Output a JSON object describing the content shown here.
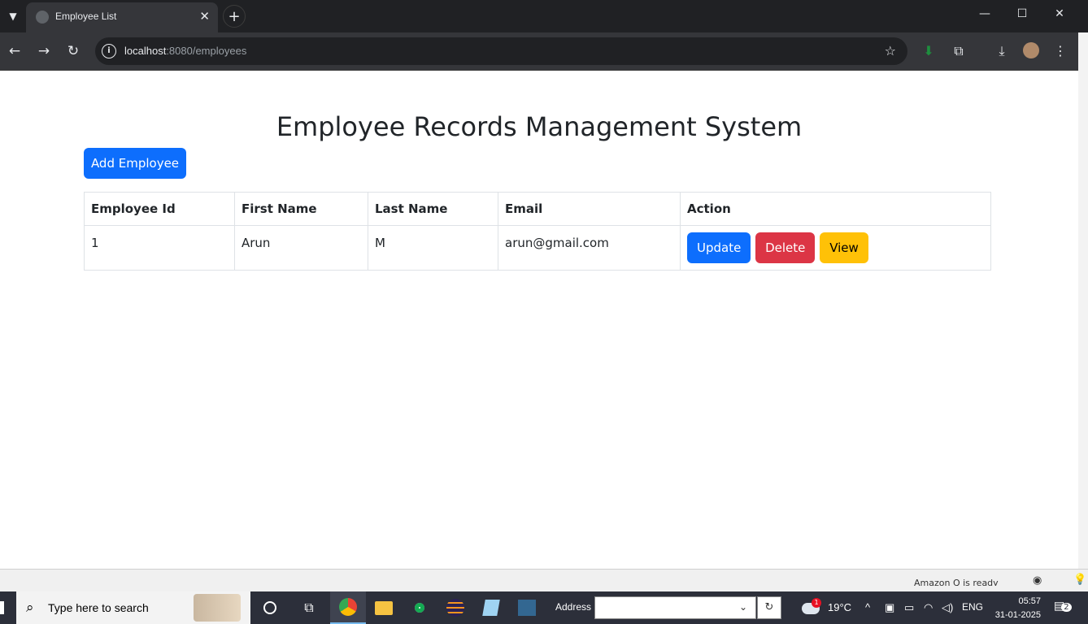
{
  "browser": {
    "tab_title": "Employee List",
    "url_host": "localhost",
    "url_rest": ":8080/employees"
  },
  "page": {
    "title": "Employee Records Management System",
    "add_button": "Add Employee",
    "table": {
      "headers": [
        "Employee Id",
        "First Name",
        "Last Name",
        "Email",
        "Action"
      ],
      "rows": [
        {
          "id": "1",
          "first_name": "Arun",
          "last_name": "M",
          "email": "arun@gmail.com"
        }
      ],
      "actions": {
        "update": "Update",
        "delete": "Delete",
        "view": "View"
      }
    }
  },
  "statusbar": {
    "text": "Amazon Q is ready"
  },
  "taskbar": {
    "search_placeholder": "Type here to search",
    "address_label": "Address",
    "temperature": "19°C",
    "language": "ENG",
    "time": "05:57",
    "date": "31-01-2025",
    "notification_count": "2",
    "weather_badge": "1"
  },
  "colors": {
    "primary": "#0d6efd",
    "danger": "#dc3545",
    "warning": "#ffc107"
  }
}
